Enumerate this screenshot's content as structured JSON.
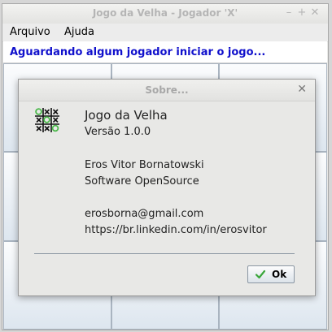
{
  "window": {
    "title": "Jogo da Velha - Jogador 'X'",
    "controls": {
      "minimize": "–",
      "maximize": "+",
      "close": "✕"
    }
  },
  "menu": {
    "items": [
      "Arquivo",
      "Ajuda"
    ]
  },
  "status": {
    "text": "Aguardando algum jogador iniciar o jogo..."
  },
  "dialog": {
    "title": "Sobre...",
    "close_icon": "✕",
    "lines": {
      "app_name": "Jogo da Velha",
      "version": "Versão 1.0.0",
      "author": "Eros Vitor Bornatowski",
      "license": "Software OpenSource",
      "email": "erosborna@gmail.com",
      "link": "https://br.linkedin.com/in/erosvitor"
    },
    "ok_label": "Ok"
  },
  "colors": {
    "status_text": "#1010cc",
    "logo_green": "#4ab84a",
    "check_green": "#3aa63a"
  }
}
